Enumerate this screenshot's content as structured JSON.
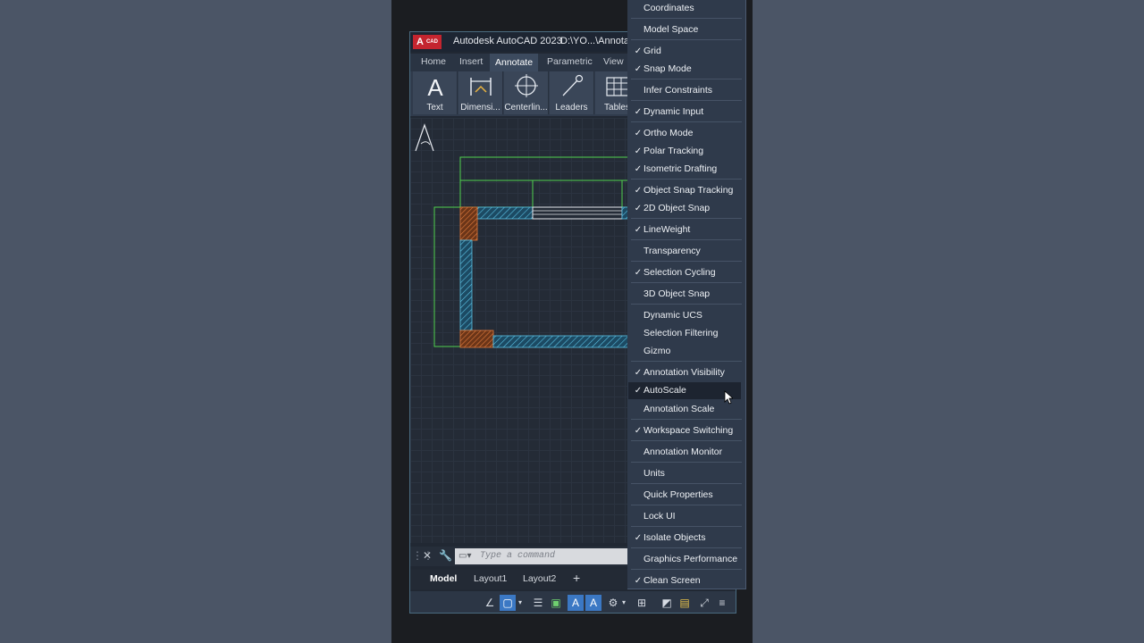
{
  "window": {
    "logo": "A",
    "logo_sub": "CAD",
    "title": "Autodesk AutoCAD 2023",
    "path": "D:\\YO...\\Annotati"
  },
  "ribbon_tabs": [
    "Home",
    "Insert",
    "Annotate",
    "Parametric",
    "View"
  ],
  "active_tab": "Annotate",
  "ribbon_buttons": [
    {
      "label": "Text",
      "icon": "text-icon"
    },
    {
      "label": "Dimensi...",
      "icon": "dimension-icon"
    },
    {
      "label": "Centerlin...",
      "icon": "centerline-icon"
    },
    {
      "label": "Leaders",
      "icon": "leader-icon"
    },
    {
      "label": "Tables",
      "icon": "table-icon"
    }
  ],
  "command_line": {
    "placeholder": "Type a command"
  },
  "layout_tabs": [
    "Model",
    "Layout1",
    "Layout2"
  ],
  "layout_add": "+",
  "menu_items": [
    {
      "label": "Coordinates",
      "checked": false
    },
    {
      "label": "Model Space",
      "checked": false
    },
    {
      "label": "Grid",
      "checked": true
    },
    {
      "label": "Snap Mode",
      "checked": true
    },
    {
      "label": "Infer Constraints",
      "checked": false
    },
    {
      "label": "Dynamic Input",
      "checked": true
    },
    {
      "label": "Ortho Mode",
      "checked": true
    },
    {
      "label": "Polar Tracking",
      "checked": true
    },
    {
      "label": "Isometric Drafting",
      "checked": true
    },
    {
      "label": "Object Snap Tracking",
      "checked": true
    },
    {
      "label": "2D Object Snap",
      "checked": true
    },
    {
      "label": "LineWeight",
      "checked": true
    },
    {
      "label": "Transparency",
      "checked": false
    },
    {
      "label": "Selection Cycling",
      "checked": true
    },
    {
      "label": "3D Object Snap",
      "checked": false
    },
    {
      "label": "Dynamic UCS",
      "checked": false
    },
    {
      "label": "Selection Filtering",
      "checked": false
    },
    {
      "label": "Gizmo",
      "checked": false
    },
    {
      "label": "Annotation Visibility",
      "checked": true
    },
    {
      "label": "AutoScale",
      "checked": true
    },
    {
      "label": "Annotation Scale",
      "checked": false
    },
    {
      "label": "Workspace Switching",
      "checked": true
    },
    {
      "label": "Annotation Monitor",
      "checked": false
    },
    {
      "label": "Units",
      "checked": false
    },
    {
      "label": "Quick Properties",
      "checked": false
    },
    {
      "label": "Lock UI",
      "checked": false
    },
    {
      "label": "Isolate Objects",
      "checked": true
    },
    {
      "label": "Graphics Performance",
      "checked": false
    },
    {
      "label": "Clean Screen",
      "checked": true
    }
  ],
  "hovered_item": "AutoScale",
  "colors": {
    "accent": "#3b78c4",
    "hatch_blue": "#4fb3d9",
    "hatch_orange": "#d0763a",
    "outline_green": "#4fd14f"
  }
}
